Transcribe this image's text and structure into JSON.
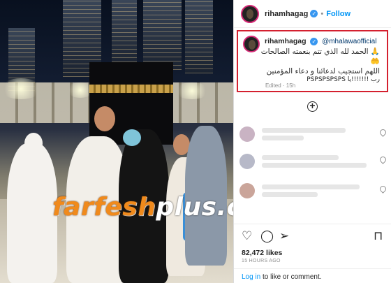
{
  "post": {
    "username": "rihamhagag",
    "follow_separator": "•",
    "follow_label": "Follow"
  },
  "caption": {
    "username": "rihamhagag",
    "mention": "@mhalawaofficial",
    "line_ar_1": "🙏 الحمد لله الذي تتم بنعمته الصالحات",
    "line_ar_2": "🤲",
    "line_ar_3": "اللهم استجيب لدعائنا و دعاء المؤمنين",
    "line_ar_4": "رب !!!!!!!يا PSPSPSPSPS",
    "edited": "Edited · 15h"
  },
  "actions": {
    "like_icon": "heart-icon",
    "comment_icon": "comment-icon",
    "share_icon": "share-icon",
    "save_icon": "bookmark-icon"
  },
  "likes": "82,472 likes",
  "time_ago": "15 HOURS AGO",
  "footer": {
    "login": "Log in",
    "rest": " to like or comment."
  },
  "watermark": {
    "part1": "farfesh",
    "part2": "plus.com"
  },
  "colors": {
    "accent": "#0095f6",
    "highlight_border": "#d4202f",
    "verified": "#3897f0"
  }
}
